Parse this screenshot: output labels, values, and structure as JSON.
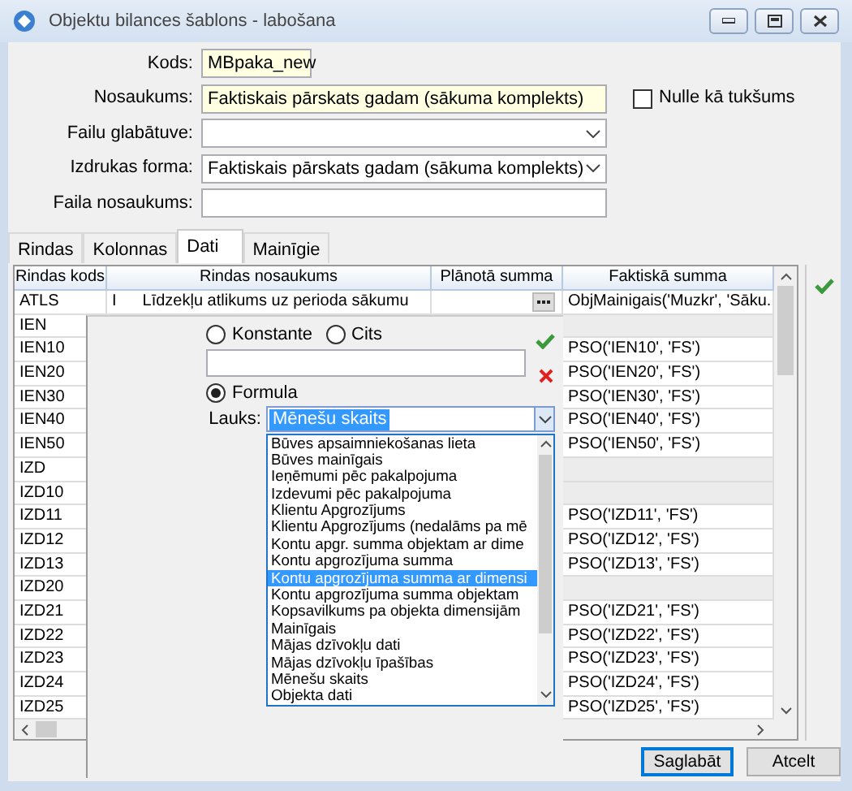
{
  "window": {
    "title": "Objektu bilances šablons - labošana"
  },
  "form": [
    {
      "label": "Kods:",
      "kind": "short_input",
      "required": true,
      "value": "MBpaka_new"
    },
    {
      "label": "Nosaukums:",
      "kind": "input",
      "required": true,
      "value": "Faktiskais pārskats gadam (sākuma komplekts)"
    },
    {
      "label": "Failu glabātuve:",
      "kind": "select",
      "required": false
    },
    {
      "label": "Izdrukas forma:",
      "kind": "select",
      "required": false,
      "value": "Faktiskais pārskats gadam (sākuma komplekts)"
    },
    {
      "label": "Faila nosaukums:",
      "kind": "input",
      "required": false
    }
  ],
  "nulle_checkbox": {
    "label": "Nulle kā tukšums",
    "checked": false
  },
  "tabs": [
    {
      "label": "Rindas",
      "selected": false
    },
    {
      "label": "Kolonnas",
      "selected": false
    },
    {
      "label": "Dati",
      "selected": true
    },
    {
      "label": "Mainīgie",
      "selected": false
    }
  ],
  "grid": {
    "columns": [
      "Rindas kods",
      "Rindas nosaukums",
      "Plānotā summa",
      "Faktiskā summa"
    ],
    "rows": [
      {
        "code": "ATLS",
        "mark": "I",
        "name": "Līdzekļu atlikums uz perioda sākumu",
        "fact": "ObjMainigais('Muzkr', 'Sāku."
      },
      {
        "code": "IEN"
      },
      {
        "code": "IEN10",
        "fact": "PSO('IEN10', 'FS')"
      },
      {
        "code": "IEN20",
        "fact": "PSO('IEN20', 'FS')"
      },
      {
        "code": "IEN30",
        "fact": "PSO('IEN30', 'FS')"
      },
      {
        "code": "IEN40",
        "fact": "PSO('IEN40', 'FS')"
      },
      {
        "code": "IEN50",
        "fact": "PSO('IEN50', 'FS')"
      },
      {
        "code": "IZD"
      },
      {
        "code": "IZD10"
      },
      {
        "code": "IZD11",
        "fact": "PSO('IZD11', 'FS')"
      },
      {
        "code": "IZD12",
        "fact": "PSO('IZD12', 'FS')"
      },
      {
        "code": "IZD13",
        "fact": "PSO('IZD13', 'FS')"
      },
      {
        "code": "IZD20"
      },
      {
        "code": "IZD21",
        "fact": "PSO('IZD21', 'FS')"
      },
      {
        "code": "IZD22",
        "fact": "PSO('IZD22', 'FS')"
      },
      {
        "code": "IZD23",
        "fact": "PSO('IZD23', 'FS')"
      },
      {
        "code": "IZD24",
        "fact": "PSO('IZD24', 'FS')"
      },
      {
        "code": "IZD25",
        "fact": "PSO('IZD25', 'FS')"
      }
    ]
  },
  "editor": {
    "radios": [
      {
        "label": "Konstante",
        "selected": false
      },
      {
        "label": "Cits",
        "selected": false
      },
      {
        "label": "Formula",
        "selected": true
      }
    ],
    "lauks": {
      "label": "Lauks:",
      "value": "Mēnešu skaits"
    },
    "options": [
      {
        "label": "Būves apsaimniekošanas lieta",
        "selected": false
      },
      {
        "label": "Būves mainīgais",
        "selected": false
      },
      {
        "label": "Ieņēmumi pēc pakalpojuma",
        "selected": false
      },
      {
        "label": "Izdevumi pēc pakalpojuma",
        "selected": false
      },
      {
        "label": "Klientu Apgrozījums",
        "selected": false
      },
      {
        "label": "Klientu Apgrozījums (nedalāms pa mē",
        "selected": false
      },
      {
        "label": "Kontu apgr. summa objektam ar dime",
        "selected": false
      },
      {
        "label": "Kontu apgrozījuma summa",
        "selected": false
      },
      {
        "label": "Kontu apgrozījuma summa ar dimensi",
        "selected": true
      },
      {
        "label": "Kontu apgrozījuma summa objektam",
        "selected": false
      },
      {
        "label": "Kopsavilkums pa objekta dimensijām",
        "selected": false
      },
      {
        "label": "Mainīgais",
        "selected": false
      },
      {
        "label": "Mājas dzīvokļu dati",
        "selected": false
      },
      {
        "label": "Mājas dzīvokļu īpašības",
        "selected": false
      },
      {
        "label": "Mēnešu skaits",
        "selected": false
      },
      {
        "label": "Objekta dati",
        "selected": false
      }
    ]
  },
  "buttons": [
    {
      "label": "Saglabāt",
      "default": true
    },
    {
      "label": "Atcelt",
      "default": false
    }
  ]
}
